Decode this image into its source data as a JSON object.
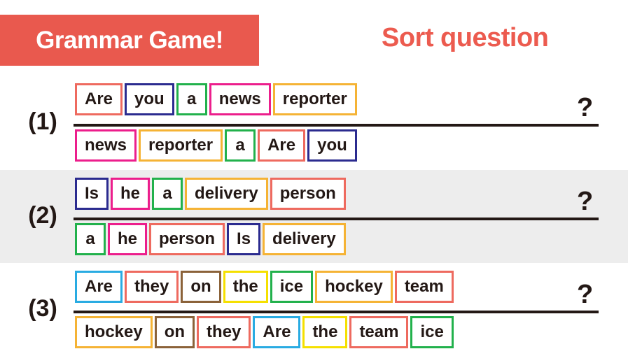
{
  "header": {
    "band_label": "Grammar Game!",
    "subtitle": "Sort question",
    "band_color": "#E9594E",
    "subtitle_color": "#EC5B4F"
  },
  "palette": {
    "salmon": "#EE6A5F",
    "navy": "#2B2B8F",
    "green": "#22B14C",
    "magenta": "#EC1E8C",
    "orange": "#F5B335",
    "cyan": "#29ABE2",
    "brown": "#8B6239",
    "yellow": "#F5E000"
  },
  "row_stripe_color": "#EDEDED",
  "question_mark": "?",
  "rows": [
    {
      "number": "(1)",
      "qmark": "?",
      "answer": [
        {
          "word": "Are",
          "color": "#EE6A5F"
        },
        {
          "word": "you",
          "color": "#2B2B8F"
        },
        {
          "word": "a",
          "color": "#22B14C"
        },
        {
          "word": "news",
          "color": "#EC1E8C"
        },
        {
          "word": "reporter",
          "color": "#F5B335"
        }
      ],
      "scrambled": [
        {
          "word": "news",
          "color": "#EC1E8C"
        },
        {
          "word": "reporter",
          "color": "#F5B335"
        },
        {
          "word": "a",
          "color": "#22B14C"
        },
        {
          "word": "Are",
          "color": "#EE6A5F"
        },
        {
          "word": "you",
          "color": "#2B2B8F"
        }
      ]
    },
    {
      "number": "(2)",
      "qmark": "?",
      "answer": [
        {
          "word": "Is",
          "color": "#2B2B8F"
        },
        {
          "word": "he",
          "color": "#EC1E8C"
        },
        {
          "word": "a",
          "color": "#22B14C"
        },
        {
          "word": "delivery",
          "color": "#F5B335"
        },
        {
          "word": "person",
          "color": "#EE6A5F"
        }
      ],
      "scrambled": [
        {
          "word": "a",
          "color": "#22B14C"
        },
        {
          "word": "he",
          "color": "#EC1E8C"
        },
        {
          "word": "person",
          "color": "#EE6A5F"
        },
        {
          "word": "Is",
          "color": "#2B2B8F"
        },
        {
          "word": "delivery",
          "color": "#F5B335"
        }
      ]
    },
    {
      "number": "(3)",
      "qmark": "?",
      "answer": [
        {
          "word": "Are",
          "color": "#29ABE2"
        },
        {
          "word": "they",
          "color": "#EE6A5F"
        },
        {
          "word": "on",
          "color": "#8B6239"
        },
        {
          "word": "the",
          "color": "#F5E000"
        },
        {
          "word": "ice",
          "color": "#22B14C"
        },
        {
          "word": "hockey",
          "color": "#F5B335"
        },
        {
          "word": "team",
          "color": "#EE6A5F"
        }
      ],
      "scrambled": [
        {
          "word": "hockey",
          "color": "#F5B335"
        },
        {
          "word": "on",
          "color": "#8B6239"
        },
        {
          "word": "they",
          "color": "#EE6A5F"
        },
        {
          "word": "Are",
          "color": "#29ABE2"
        },
        {
          "word": "the",
          "color": "#F5E000"
        },
        {
          "word": "team",
          "color": "#EE6A5F"
        },
        {
          "word": "ice",
          "color": "#22B14C"
        }
      ]
    }
  ]
}
